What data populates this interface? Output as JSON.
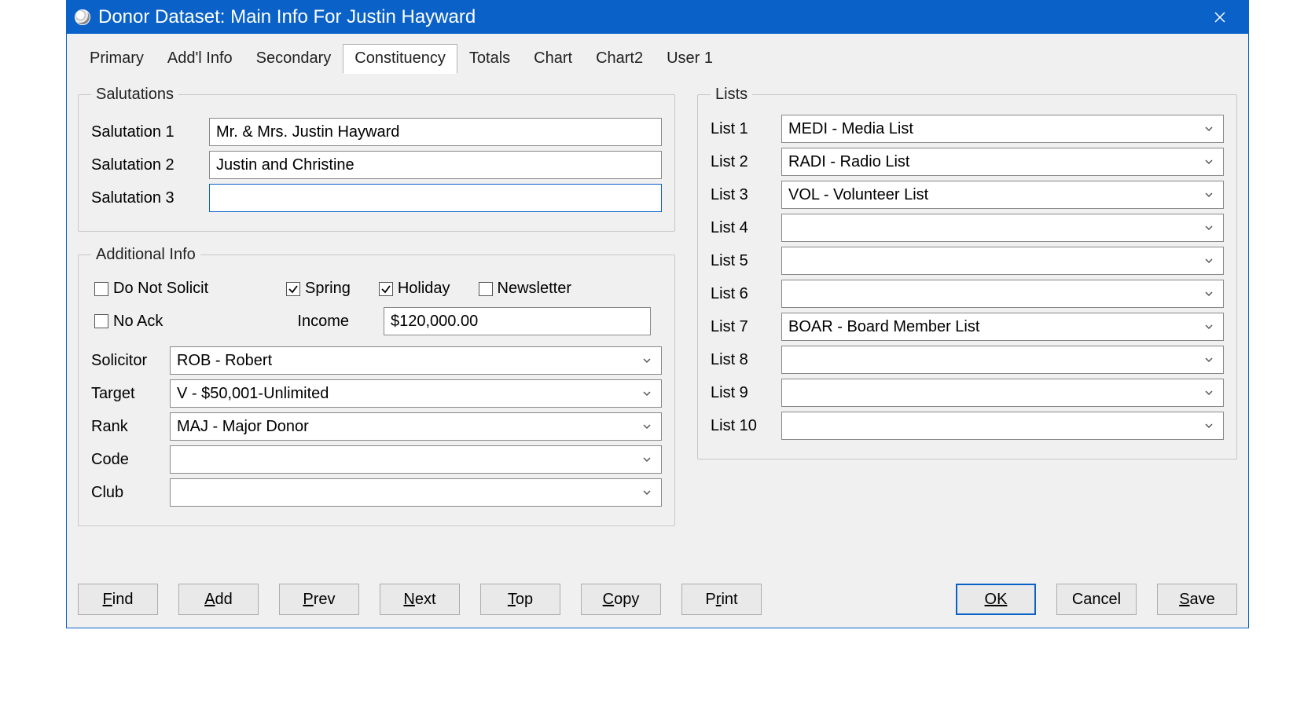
{
  "window": {
    "title": "Donor Dataset: Main Info For Justin Hayward"
  },
  "tabs": {
    "items": [
      "Primary",
      "Add'l Info",
      "Secondary",
      "Constituency",
      "Totals",
      "Chart",
      "Chart2",
      "User 1"
    ],
    "active": "Constituency"
  },
  "salutations": {
    "legend": "Salutations",
    "label1": "Salutation 1",
    "value1": "Mr. & Mrs. Justin Hayward",
    "label2": "Salutation 2",
    "value2": "Justin and Christine",
    "label3": "Salutation 3",
    "value3": ""
  },
  "additional": {
    "legend": "Additional Info",
    "doNotSolicit": {
      "label": "Do Not Solicit",
      "checked": false
    },
    "spring": {
      "label": "Spring",
      "checked": true
    },
    "holiday": {
      "label": "Holiday",
      "checked": true
    },
    "newsletter": {
      "label": "Newsletter",
      "checked": false
    },
    "noAck": {
      "label": "No Ack",
      "checked": false
    },
    "incomeLabel": "Income",
    "incomeValue": "$120,000.00",
    "solicitor": {
      "label": "Solicitor",
      "value": "ROB - Robert"
    },
    "target": {
      "label": "Target",
      "value": "V - $50,001-Unlimited"
    },
    "rank": {
      "label": "Rank",
      "value": "MAJ - Major Donor"
    },
    "code": {
      "label": "Code",
      "value": ""
    },
    "club": {
      "label": "Club",
      "value": ""
    }
  },
  "lists": {
    "legend": "Lists",
    "items": [
      {
        "label": "List 1",
        "value": "MEDI - Media List"
      },
      {
        "label": "List 2",
        "value": "RADI - Radio List"
      },
      {
        "label": "List 3",
        "value": "VOL - Volunteer List"
      },
      {
        "label": "List 4",
        "value": ""
      },
      {
        "label": "List 5",
        "value": ""
      },
      {
        "label": "List 6",
        "value": ""
      },
      {
        "label": "List 7",
        "value": "BOAR - Board Member List"
      },
      {
        "label": "List 8",
        "value": ""
      },
      {
        "label": "List 9",
        "value": ""
      },
      {
        "label": "List 10",
        "value": ""
      }
    ]
  },
  "buttons": {
    "find": "Find",
    "add": "Add",
    "prev": "Prev",
    "next": "Next",
    "top": "Top",
    "copy": "Copy",
    "print": "Print",
    "ok": "OK",
    "cancel": "Cancel",
    "save": "Save"
  }
}
